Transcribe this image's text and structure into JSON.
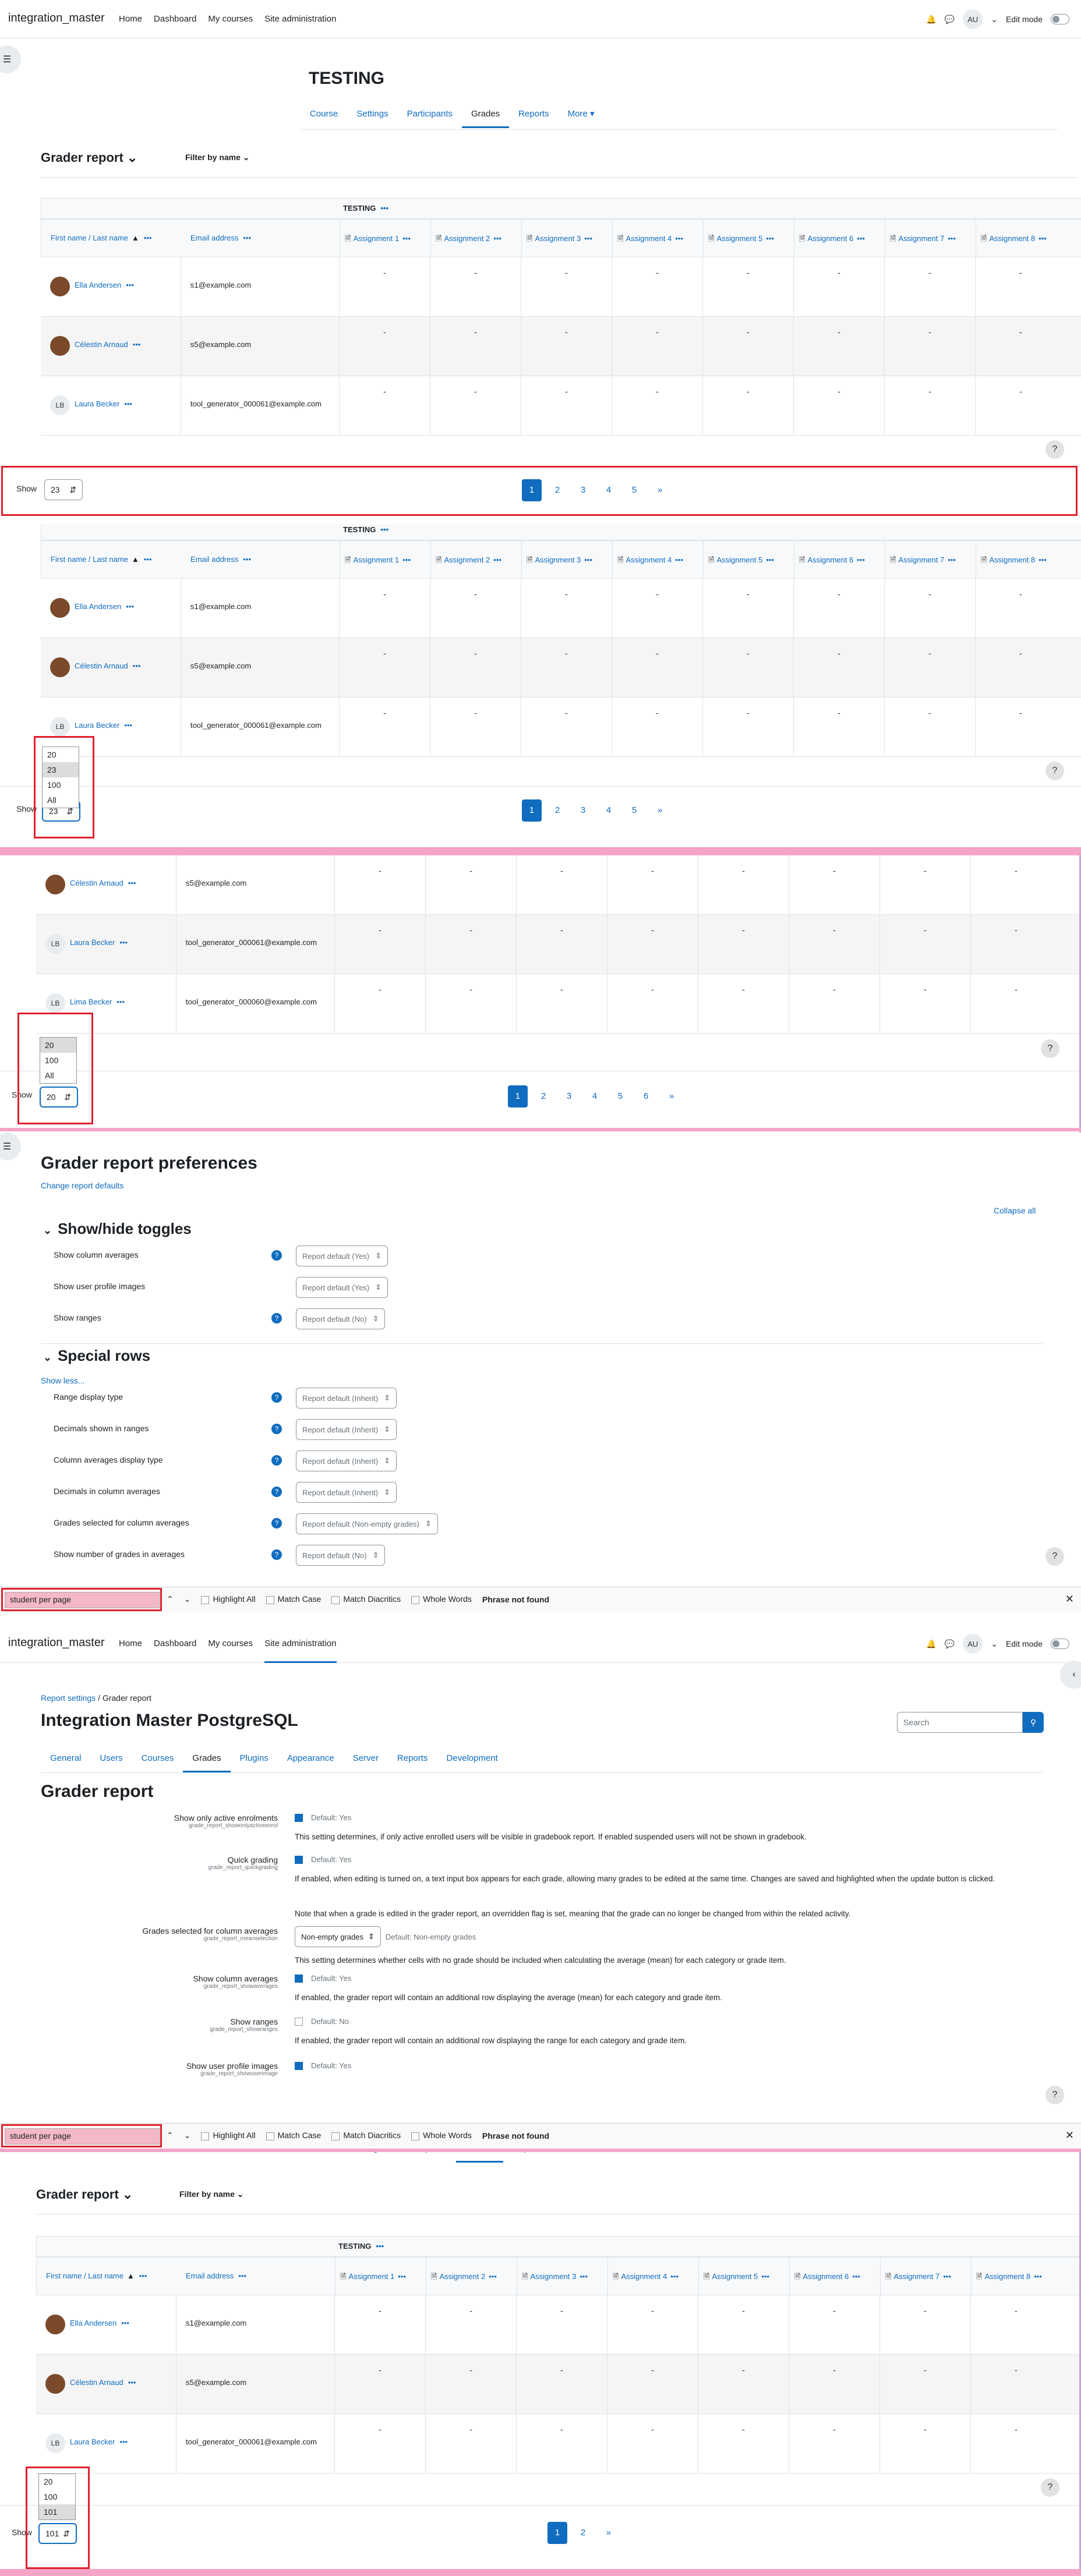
{
  "nav": {
    "brand": "integration_master",
    "links": [
      "Home",
      "Dashboard",
      "My courses",
      "Site administration"
    ],
    "user_initials": "AU",
    "edit_mode": "Edit mode"
  },
  "course": {
    "title": "TESTING",
    "tabs": [
      "Course",
      "Settings",
      "Participants",
      "Grades",
      "Reports",
      "More ▾"
    ]
  },
  "grader": {
    "title": "Grader report ⌄",
    "filter": "Filter by name ⌄",
    "category": "TESTING",
    "col_name": "First name / Last name",
    "col_email": "Email address",
    "assignments": [
      "Assignment 1",
      "Assignment 2",
      "Assignment 3",
      "Assignment 4",
      "Assignment 5",
      "Assignment 6",
      "Assignment 7",
      "Assignment 8"
    ],
    "students": [
      {
        "name": "Ella Andersen",
        "email": "s1@example.com",
        "initials": ""
      },
      {
        "name": "Célestin Arnaud",
        "email": "s5@example.com",
        "initials": ""
      },
      {
        "name": "Laura Becker",
        "email": "tool_generator_000061@example.com",
        "initials": "LB"
      },
      {
        "name": "Lima Becker",
        "email": "tool_generator_000060@example.com",
        "initials": "LB"
      }
    ],
    "dash": "-",
    "dots": "•••",
    "show": "Show",
    "help": "?"
  },
  "shot1": {
    "show_value": "23",
    "pages": [
      "1",
      "2",
      "3",
      "4",
      "5",
      "»"
    ]
  },
  "shot2": {
    "show_value": "23",
    "options": [
      "20",
      "23",
      "100",
      "All"
    ],
    "pages": [
      "1",
      "2",
      "3",
      "4",
      "5",
      "»"
    ]
  },
  "shot3": {
    "show_value": "20",
    "options": [
      "20",
      "100",
      "All"
    ],
    "pages": [
      "1",
      "2",
      "3",
      "4",
      "5",
      "6",
      "»"
    ]
  },
  "prefs": {
    "title": "Grader report preferences",
    "change_defaults": "Change report defaults",
    "collapse_all": "Collapse all",
    "sec1": "Show/hide toggles",
    "sec2": "Special rows",
    "show_less": "Show less...",
    "rows1": [
      {
        "label": "Show column averages",
        "value": "Report default (Yes)",
        "help": true
      },
      {
        "label": "Show user profile images",
        "value": "Report default (Yes)",
        "help": false
      },
      {
        "label": "Show ranges",
        "value": "Report default (No)",
        "help": true
      }
    ],
    "rows2": [
      {
        "label": "Range display type",
        "value": "Report default (Inherit)"
      },
      {
        "label": "Decimals shown in ranges",
        "value": "Report default (Inherit)"
      },
      {
        "label": "Column averages display type",
        "value": "Report default (Inherit)"
      },
      {
        "label": "Decimals in column averages",
        "value": "Report default (Inherit)"
      },
      {
        "label": "Grades selected for column averages",
        "value": "Report default (Non-empty grades)"
      },
      {
        "label": "Show number of grades in averages",
        "value": "Report default (No)"
      }
    ]
  },
  "find": {
    "query": "student per page",
    "highlight": "Highlight All",
    "match_case": "Match Case",
    "diacritics": "Match Diacritics",
    "whole": "Whole Words",
    "status": "Phrase not found"
  },
  "admin": {
    "crumb1": "Report settings",
    "crumb2": "Grader report",
    "site": "Integration Master PostgreSQL",
    "search_ph": "Search",
    "tabs": [
      "General",
      "Users",
      "Courses",
      "Grades",
      "Plugins",
      "Appearance",
      "Server",
      "Reports",
      "Development"
    ],
    "title": "Grader report",
    "settings": [
      {
        "label": "Show only active enrolments",
        "key": "grade_report_showonlyactiveenrol",
        "checked": true,
        "default": "Default: Yes",
        "desc": "This setting determines, if only active enrolled users will be visible in gradebook report. If enabled suspended users will not be shown in gradebook."
      },
      {
        "label": "Quick grading",
        "key": "grade_report_quickgrading",
        "checked": true,
        "default": "Default: Yes",
        "desc": "If enabled, when editing is turned on, a text input box appears for each grade, allowing many grades to be edited at the same time. Changes are saved and highlighted when the update button is clicked.",
        "desc2": "Note that when a grade is edited in the grader report, an overridden flag is set, meaning that the grade can no longer be changed from within the related activity."
      },
      {
        "label": "Grades selected for column averages",
        "key": "grade_report_meanselection",
        "select": "Non-empty grades",
        "default": "Default: Non-empty grades",
        "desc": "This setting determines whether cells with no grade should be included when calculating the average (mean) for each category or grade item."
      },
      {
        "label": "Show column averages",
        "key": "grade_report_showaverages",
        "checked": true,
        "default": "Default: Yes",
        "desc": "If enabled, the grader report will contain an additional row displaying the average (mean) for each category and grade item."
      },
      {
        "label": "Show ranges",
        "key": "grade_report_showranges",
        "checked": false,
        "default": "Default: No",
        "desc": "If enabled, the grader report will contain an additional row displaying the range for each category and grade item."
      },
      {
        "label": "Show user profile images",
        "key": "grade_report_showuserimage",
        "checked": true,
        "default": "Default: Yes",
        "desc": ""
      }
    ]
  },
  "shot5": {
    "tabs_partial": [
      "Course",
      "Settings",
      "Participants",
      "Grades",
      "Reports",
      "More ▾"
    ],
    "show_value": "101",
    "options": [
      "20",
      "100",
      "101"
    ],
    "pages": [
      "1",
      "2",
      "»"
    ]
  }
}
